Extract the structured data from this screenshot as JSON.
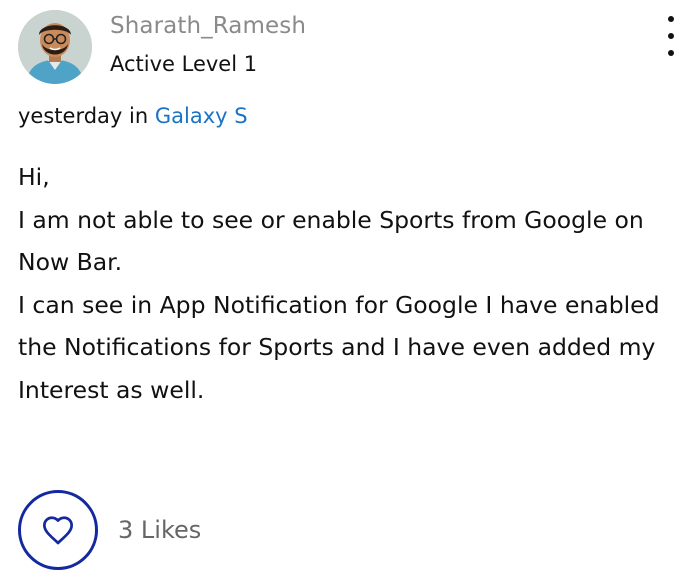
{
  "author": {
    "name": "Sharath_Ramesh",
    "rank": "Active Level 1",
    "avatar_icon": "avatar-cartoon-icon"
  },
  "menu": {
    "icon": "more-vertical-icon"
  },
  "meta": {
    "time": "yesterday",
    "in_word": "in",
    "board": "Galaxy S",
    "board_color": "#1a73c8"
  },
  "post": {
    "lines": [
      "Hi,",
      "I am not able to see or enable Sports from Google on Now Bar.",
      "I can see in App Notification for Google I have enabled the Notifications for Sports and I have even added my Interest as well."
    ]
  },
  "likes": {
    "icon": "heart-icon",
    "count_label": "3 Likes",
    "accent": "#1428a0"
  }
}
